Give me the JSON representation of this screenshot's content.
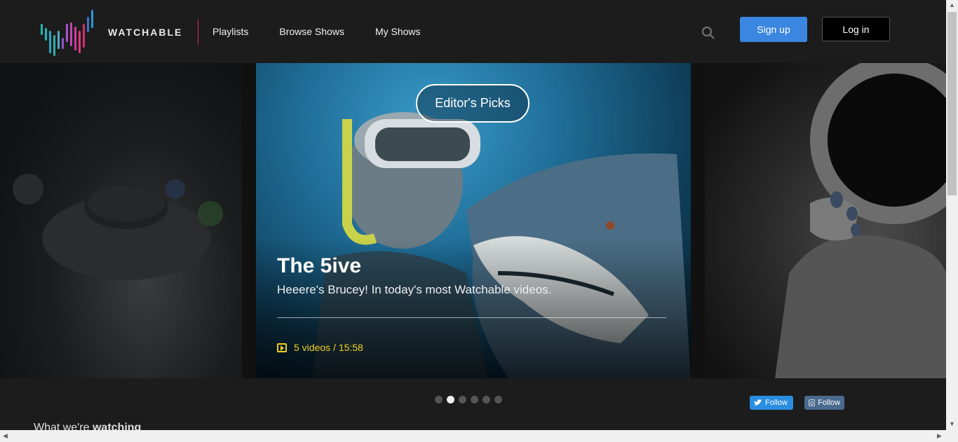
{
  "brand": {
    "name": "WATCHABLE"
  },
  "nav": {
    "items": [
      "Playlists",
      "Browse Shows",
      "My Shows"
    ]
  },
  "header": {
    "signup_label": "Sign up",
    "login_label": "Log in",
    "search_icon": "search-icon"
  },
  "hero": {
    "badge": "Editor's Picks",
    "title": "The 5ive",
    "subtitle": "Heeere's Brucey! In today's most Watchable videos.",
    "meta": "5 videos / 15:58",
    "meta_icon": "play-icon"
  },
  "carousel": {
    "dot_count": 6,
    "active_dot": 2
  },
  "social": {
    "twitter_label": "Follow",
    "instagram_label": "Follow"
  },
  "section": {
    "title_prefix": "What we're",
    "title_strong": "watching"
  },
  "colors": {
    "accent_blue": "#3a86e0",
    "brand_pink": "#d4266b",
    "meta_yellow": "#f0d020",
    "background": "#1c1c1c"
  }
}
